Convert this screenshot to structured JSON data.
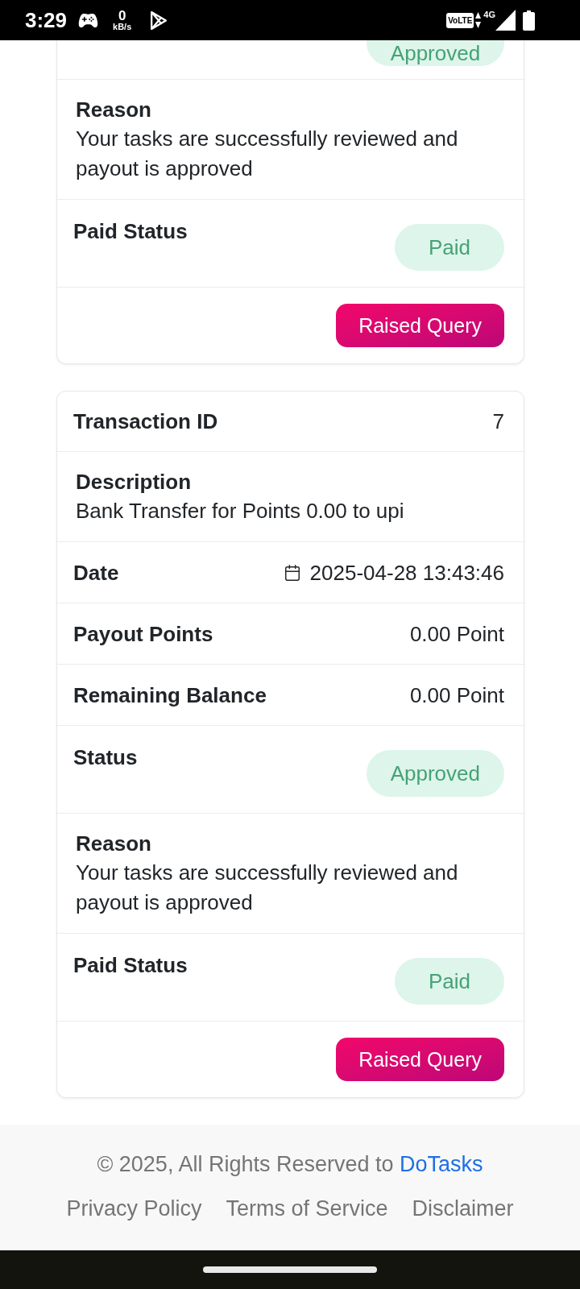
{
  "status_bar": {
    "time": "3:29",
    "speed_value": "0",
    "speed_unit": "kB/s",
    "volte": "VoLTE",
    "network": "4G"
  },
  "transactions": [
    {
      "rows": [
        {
          "kind": "clipped",
          "value": "Approved"
        },
        {
          "kind": "text",
          "label": "Reason",
          "value": "Your tasks are successfully reviewed and payout is approved"
        },
        {
          "kind": "badge",
          "label": "Paid Status",
          "value": "Paid"
        }
      ],
      "action": "Raised Query"
    },
    {
      "rows": [
        {
          "kind": "pair",
          "label": "Transaction ID",
          "value": "7"
        },
        {
          "kind": "text",
          "label": "Description",
          "value": "Bank Transfer for Points 0.00 to upi"
        },
        {
          "kind": "date",
          "label": "Date",
          "value": "2025-04-28 13:43:46"
        },
        {
          "kind": "pair",
          "label": "Payout Points",
          "value": "0.00 Point"
        },
        {
          "kind": "pair",
          "label": "Remaining Balance",
          "value": "0.00 Point"
        },
        {
          "kind": "badge",
          "label": "Status",
          "value": "Approved"
        },
        {
          "kind": "text",
          "label": "Reason",
          "value": "Your tasks are successfully reviewed and payout is approved"
        },
        {
          "kind": "badge",
          "label": "Paid Status",
          "value": "Paid"
        }
      ],
      "action": "Raised Query"
    }
  ],
  "footer": {
    "copyright": "© 2025, All Rights Reserved to",
    "brand": "DoTasks",
    "links": [
      "Privacy Policy",
      "Terms of Service",
      "Disclaimer"
    ]
  }
}
